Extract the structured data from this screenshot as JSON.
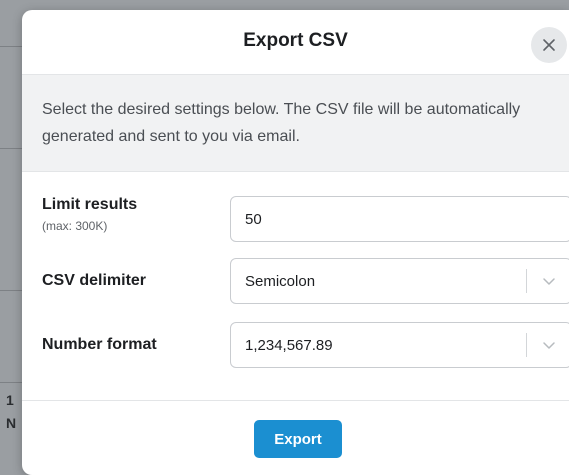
{
  "modal": {
    "title": "Export CSV",
    "close_icon": "close-icon",
    "description": "Select the desired settings below. The CSV file will be automatically generated and sent to you via email."
  },
  "form": {
    "limit": {
      "label": "Limit results",
      "sublabel": "(max: 300K)",
      "value": "50"
    },
    "delimiter": {
      "label": "CSV delimiter",
      "selected": "Semicolon",
      "icon": "chevron-down-icon"
    },
    "number_format": {
      "label": "Number format",
      "selected": "1,234,567.89",
      "icon": "chevron-down-icon"
    }
  },
  "footer": {
    "export_label": "Export"
  },
  "colors": {
    "accent": "#1b8fd1",
    "overlay": "#9a9ea2",
    "info_band": "#f1f2f3"
  }
}
